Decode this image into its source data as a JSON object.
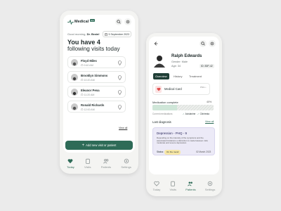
{
  "home": {
    "brand": "Medical",
    "brand_badge": "app",
    "greeting": "Good morning,",
    "doctor": "Dr. Brain!",
    "date": "5 September 2023",
    "headline_1": "You have 4",
    "headline_2": "following visits today",
    "visits": [
      {
        "name": "Floyd Miles",
        "time": "9:40 AM"
      },
      {
        "name": "Brooklyn Simmons",
        "time": "10:20 AM"
      },
      {
        "name": "Eleanor Pena",
        "time": "11:20 AM"
      },
      {
        "name": "Ronald Richards",
        "time": "12:00 AM"
      }
    ],
    "view_all": "View all",
    "add_button": "Add new visit or patient",
    "tabs": [
      {
        "label": "Today",
        "icon": "heart-icon",
        "active": true
      },
      {
        "label": "Visits",
        "icon": "clipboard-icon",
        "active": false
      },
      {
        "label": "Patients",
        "icon": "users-icon",
        "active": false
      },
      {
        "label": "Settings",
        "icon": "gear-icon",
        "active": false
      }
    ]
  },
  "patient": {
    "name": "Ralph Edwards",
    "gender": "Gender: Male",
    "age": "Age: 34",
    "patient_id": "ID: 83P-42",
    "tabs": [
      "Overview",
      "History",
      "Treatment"
    ],
    "medical_card_title": "Medical Card",
    "medical_card_badge": "PNG •",
    "medication_label": "Medication complete",
    "medication_percent": "40%",
    "medication_fraction": 0.4,
    "current_meds_label": "Current medications",
    "meds": [
      "Aviolanine",
      "Cliniresta"
    ],
    "last_diagnosis_label": "Last diagnosis",
    "view_all": "View all",
    "diagnosis_title": "Depression - PHQ - 9",
    "diagnosis_text": "Depending on the intensity of the symptoms and the associated limitations a distinction is made between mild, moderate and severe depression.",
    "status_label": "Status:",
    "status_value": "On the mend",
    "diagnosis_date": "02 March 2023",
    "nav_tabs": [
      {
        "label": "Today",
        "icon": "heart-icon",
        "active": false
      },
      {
        "label": "Visits",
        "icon": "clipboard-icon",
        "active": false
      },
      {
        "label": "Patients",
        "icon": "users-icon",
        "active": true
      },
      {
        "label": "Settings",
        "icon": "gear-icon",
        "active": false
      }
    ]
  },
  "colors": {
    "accent": "#2e6b57",
    "accent_light": "#cfe6d8",
    "diagnosis_bg": "#eceaf7",
    "status_pill": "#f7e7a6"
  }
}
